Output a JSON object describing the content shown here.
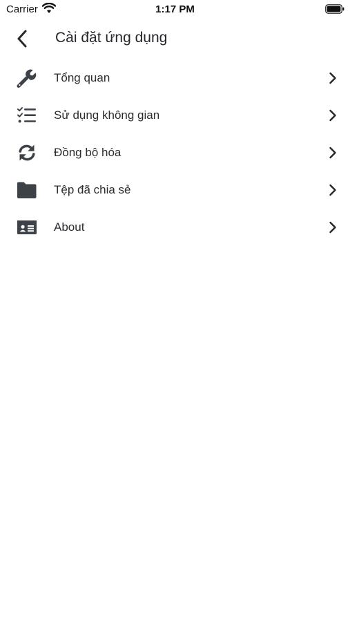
{
  "status_bar": {
    "carrier": "Carrier",
    "time": "1:17 PM"
  },
  "header": {
    "title": "Cài đặt ứng dụng",
    "back_icon": "chevron-left-icon"
  },
  "menu": {
    "items": [
      {
        "label": "Tổng quan",
        "icon": "wrench-icon"
      },
      {
        "label": "Sử dụng không gian",
        "icon": "checklist-icon"
      },
      {
        "label": "Đồng bộ hóa",
        "icon": "sync-icon"
      },
      {
        "label": "Tệp đã chia sẻ",
        "icon": "folder-icon"
      },
      {
        "label": "About",
        "icon": "id-card-icon"
      }
    ]
  },
  "colors": {
    "icon": "#3d4148",
    "text": "#2a2c30",
    "background": "#ffffff"
  }
}
